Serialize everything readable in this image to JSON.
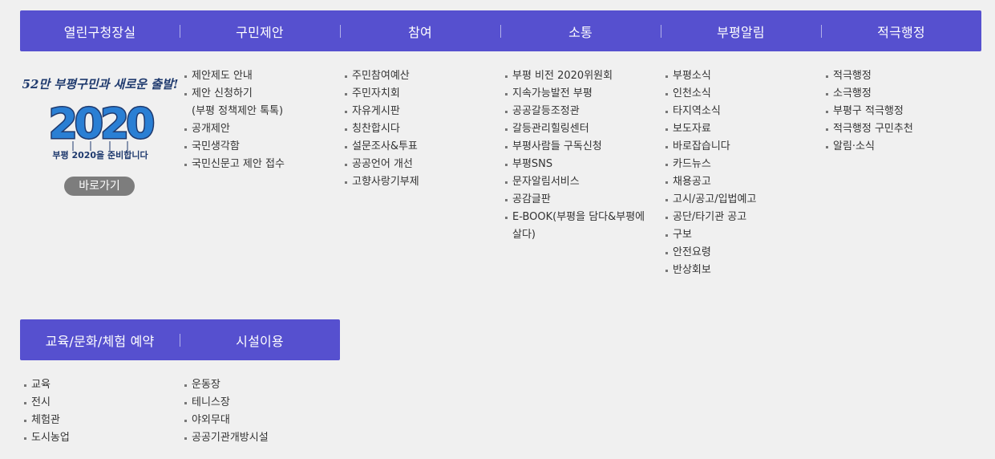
{
  "top_nav": {
    "tabs": [
      "열린구청장실",
      "구민제안",
      "참여",
      "소통",
      "부평알림",
      "적극행정"
    ]
  },
  "banner": {
    "slogan": "52만 부평구민과 새로운 출발!",
    "year": "2020",
    "ribbon_text": "부평 2020을 준비합니다",
    "button_label": "바로가기"
  },
  "columns": {
    "proposal": [
      {
        "label": "제안제도 안내"
      },
      {
        "label": "제안 신청하기",
        "sub": "(부평 정책제안 톡톡)"
      },
      {
        "label": "공개제안"
      },
      {
        "label": "국민생각함"
      },
      {
        "label": "국민신문고 제안 접수"
      }
    ],
    "participation": [
      "주민참여예산",
      "주민자치회",
      "자유게시판",
      "칭찬합시다",
      "설문조사&투표",
      "공공언어 개선",
      "고향사랑기부제"
    ],
    "communication": [
      {
        "label": "부평 비전 2020위원회"
      },
      {
        "label": "지속가능발전 부평"
      },
      {
        "label": "공공갈등조정관"
      },
      {
        "label": "갈등관리힐링센터"
      },
      {
        "label": "부평사람들 구독신청"
      },
      {
        "label": "부평SNS"
      },
      {
        "label": "문자알림서비스"
      },
      {
        "label": "공감글판"
      },
      {
        "label": "E-BOOK(부평을 담다&부평에",
        "sub": "살다)"
      }
    ],
    "notice": [
      "부평소식",
      "인천소식",
      "타지역소식",
      "보도자료",
      "바로잡습니다",
      "카드뉴스",
      "채용공고",
      "고시/공고/입법예고",
      "공단/타기관 공고",
      "구보",
      "안전요령",
      "반상회보"
    ],
    "proactive": [
      "적극행정",
      "소극행정",
      "부평구 적극행정",
      "적극행정 구민추천",
      "알림·소식"
    ]
  },
  "bottom_nav": {
    "tabs": [
      "교육/문화/체험 예약",
      "시설이용"
    ]
  },
  "bottom_columns": {
    "education": [
      "교육",
      "전시",
      "체험관",
      "도시농업"
    ],
    "facilities": [
      "운동장",
      "테니스장",
      "야외무대",
      "공공기관개방시설"
    ]
  },
  "colors": {
    "nav_bg": "#5650cf",
    "button_bg": "#7d7d7d",
    "page_bg": "#f0f0f0",
    "banner_navy": "#1f3a6e",
    "banner_blue": "#2a7fd4"
  }
}
